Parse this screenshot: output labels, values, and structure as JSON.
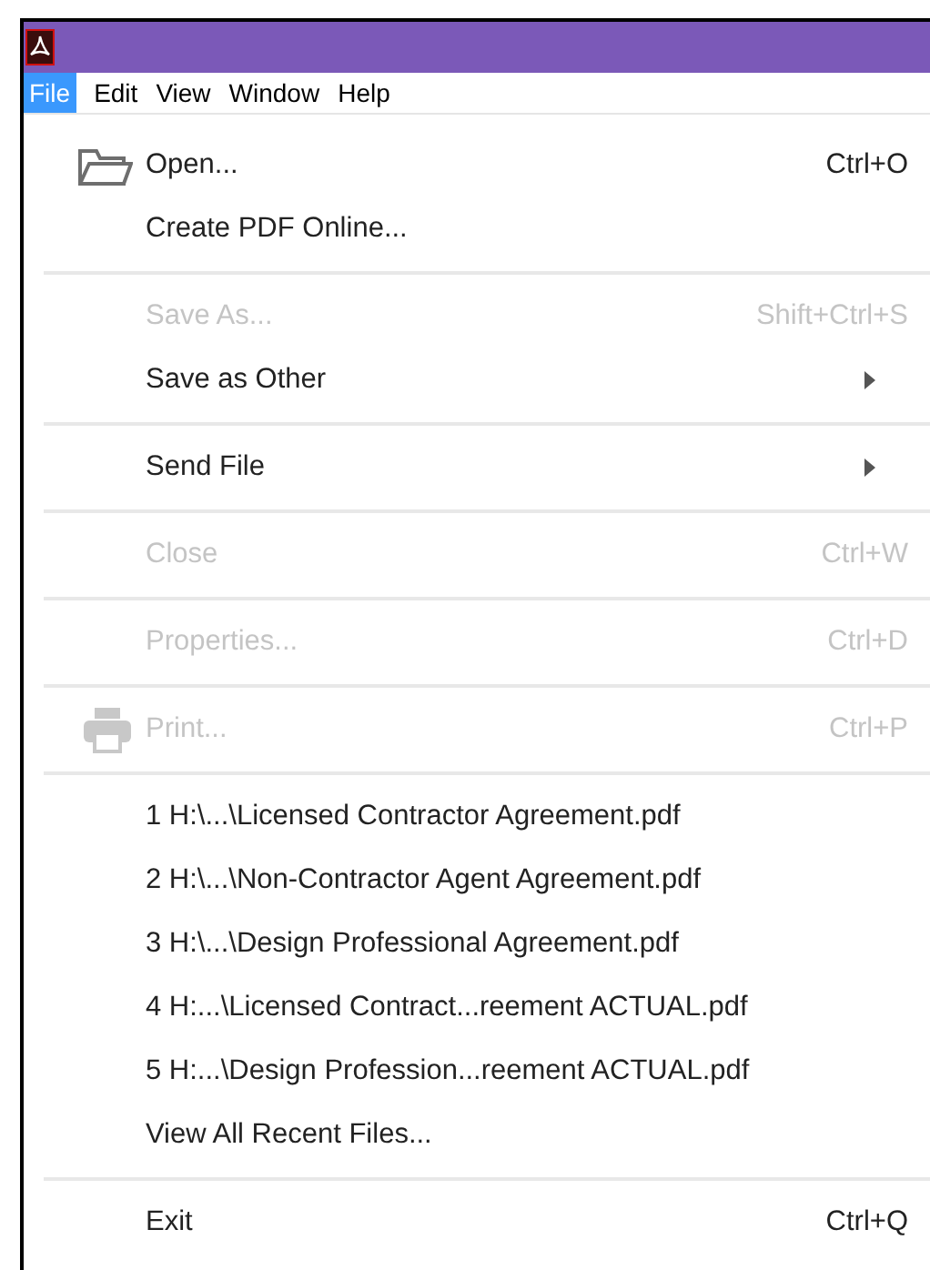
{
  "menubar": [
    {
      "label": "File",
      "selected": true
    },
    {
      "label": "Edit",
      "selected": false
    },
    {
      "label": "View",
      "selected": false
    },
    {
      "label": "Window",
      "selected": false
    },
    {
      "label": "Help",
      "selected": false
    }
  ],
  "menu": [
    {
      "kind": "folder",
      "label": "Open...",
      "shortcut": "Ctrl+O",
      "disabled": false
    },
    {
      "kind": "item",
      "label": "Create PDF Online...",
      "disabled": false
    },
    {
      "kind": "separator"
    },
    {
      "kind": "item",
      "label": "Save As...",
      "shortcut": "Shift+Ctrl+S",
      "disabled": true
    },
    {
      "kind": "submenu",
      "label": "Save as Other",
      "disabled": false
    },
    {
      "kind": "separator"
    },
    {
      "kind": "submenu",
      "label": "Send File",
      "disabled": false
    },
    {
      "kind": "separator"
    },
    {
      "kind": "item",
      "label": "Close",
      "shortcut": "Ctrl+W",
      "disabled": true
    },
    {
      "kind": "separator"
    },
    {
      "kind": "item",
      "label": "Properties...",
      "shortcut": "Ctrl+D",
      "disabled": true
    },
    {
      "kind": "separator"
    },
    {
      "kind": "printer",
      "label": "Print...",
      "shortcut": "Ctrl+P",
      "disabled": true
    },
    {
      "kind": "separator"
    },
    {
      "kind": "item",
      "label": "1 H:\\...\\Licensed Contractor Agreement.pdf",
      "disabled": false
    },
    {
      "kind": "item",
      "label": "2 H:\\...\\Non-Contractor Agent Agreement.pdf",
      "disabled": false
    },
    {
      "kind": "item",
      "label": "3 H:\\...\\Design Professional Agreement.pdf",
      "disabled": false
    },
    {
      "kind": "item",
      "label": "4 H:...\\Licensed Contract...reement ACTUAL.pdf",
      "disabled": false
    },
    {
      "kind": "item",
      "label": "5 H:...\\Design Profession...reement ACTUAL.pdf",
      "disabled": false
    },
    {
      "kind": "item",
      "label": "View All Recent Files...",
      "disabled": false
    },
    {
      "kind": "separator"
    },
    {
      "kind": "item",
      "label": "Exit",
      "shortcut": "Ctrl+Q",
      "disabled": false
    }
  ]
}
